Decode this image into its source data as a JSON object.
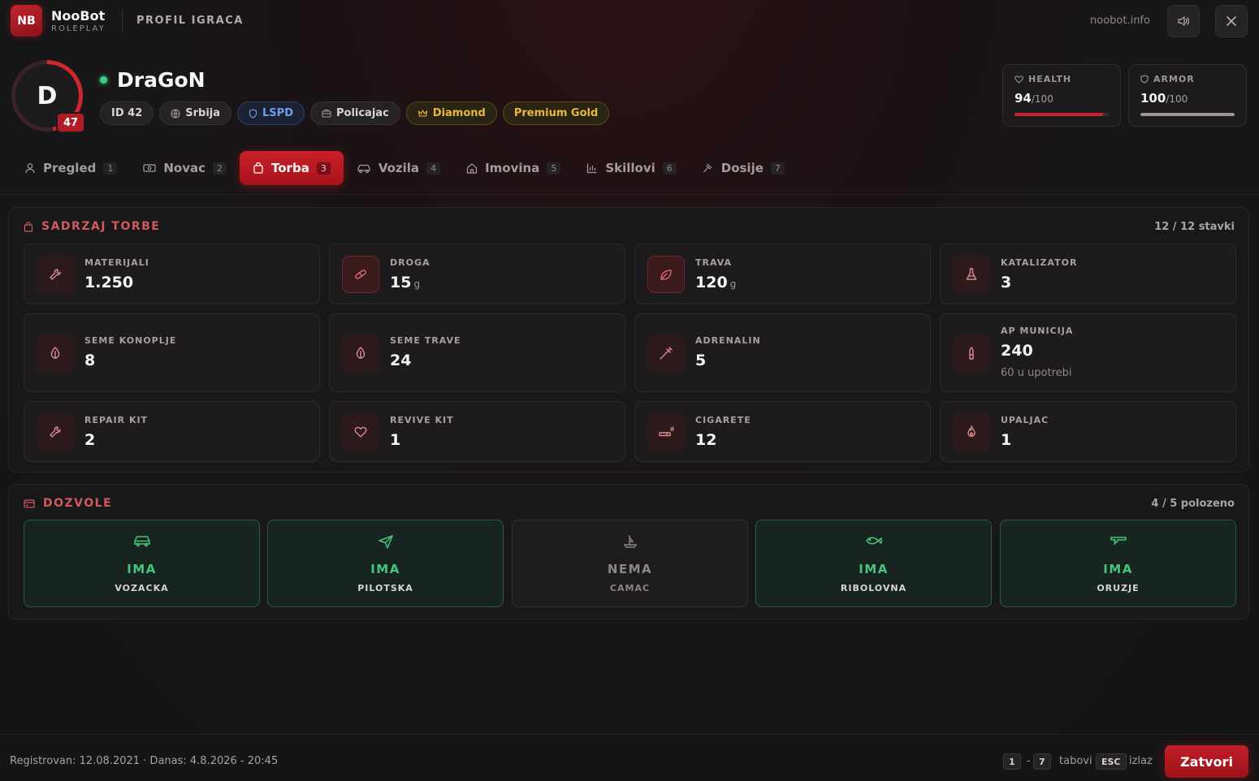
{
  "header": {
    "logo": "NB",
    "brand": "NooBot",
    "brand_sub": "ROLEPLAY",
    "page_title": "PROFIL IGRACA",
    "site": "noobot.info"
  },
  "profile": {
    "avatar_letter": "D",
    "level": "47",
    "name": "DraGoN",
    "status_color": "#3ecf7a",
    "chips": {
      "id": "ID 42",
      "country": "Srbija",
      "faction": "LSPD",
      "job": "Policajac",
      "rank": "Diamond",
      "premium": "Premium Gold"
    }
  },
  "stats": {
    "health": {
      "label": "HEALTH",
      "value": "94",
      "max": "/100",
      "fraction": 0.94,
      "color": "#c8232c"
    },
    "armor": {
      "label": "ARMOR",
      "value": "100",
      "max": "/100",
      "fraction": 1.0,
      "color": "#9a9596"
    }
  },
  "tabs": [
    {
      "label": "Pregled",
      "num": "1",
      "icon": "user-icon"
    },
    {
      "label": "Novac",
      "num": "2",
      "icon": "money-icon"
    },
    {
      "label": "Torba",
      "num": "3",
      "icon": "bag-icon",
      "active": true
    },
    {
      "label": "Vozila",
      "num": "4",
      "icon": "car-icon"
    },
    {
      "label": "Imovina",
      "num": "5",
      "icon": "house-icon"
    },
    {
      "label": "Skillovi",
      "num": "6",
      "icon": "chart-icon"
    },
    {
      "label": "Dosije",
      "num": "7",
      "icon": "gavel-icon"
    }
  ],
  "inventory": {
    "title": "SADRZAJ TORBE",
    "count": "12 / 12 stavki",
    "items": [
      {
        "label": "MATERIJALI",
        "value": "1.250",
        "unit": "",
        "icon": "wrench-icon"
      },
      {
        "label": "DROGA",
        "value": "15",
        "unit": "g",
        "icon": "pill-icon"
      },
      {
        "label": "TRAVA",
        "value": "120",
        "unit": "g",
        "icon": "leaf-icon"
      },
      {
        "label": "KATALIZATOR",
        "value": "3",
        "unit": "",
        "icon": "flask-icon"
      },
      {
        "label": "SEME KONOPLJE",
        "value": "8",
        "unit": "",
        "icon": "seed-icon"
      },
      {
        "label": "SEME TRAVE",
        "value": "24",
        "unit": "",
        "icon": "seed-icon"
      },
      {
        "label": "ADRENALIN",
        "value": "5",
        "unit": "",
        "icon": "syringe-icon"
      },
      {
        "label": "AP MUNICIJA",
        "value": "240",
        "unit": "",
        "sub": "60 u upotrebi",
        "icon": "bullet-icon"
      },
      {
        "label": "REPAIR KIT",
        "value": "2",
        "unit": "",
        "icon": "wrench-icon"
      },
      {
        "label": "REVIVE KIT",
        "value": "1",
        "unit": "",
        "icon": "heart-icon"
      },
      {
        "label": "CIGARETE",
        "value": "12",
        "unit": "",
        "icon": "cigarette-icon"
      },
      {
        "label": "UPALJAC",
        "value": "1",
        "unit": "",
        "icon": "flame-icon"
      }
    ]
  },
  "licenses": {
    "title": "DOZVOLE",
    "count": "4 / 5 polozeno",
    "items": [
      {
        "status": "IMA",
        "name": "VOZACKA",
        "icon": "car-icon",
        "has": true
      },
      {
        "status": "IMA",
        "name": "PILOTSKA",
        "icon": "plane-icon",
        "has": true
      },
      {
        "status": "NEMA",
        "name": "CAMAC",
        "icon": "boat-icon",
        "has": false
      },
      {
        "status": "IMA",
        "name": "RIBOLOVNA",
        "icon": "fish-icon",
        "has": true
      },
      {
        "status": "IMA",
        "name": "ORUZJE",
        "icon": "gun-icon",
        "has": true
      }
    ]
  },
  "footer": {
    "registered": "Registrovan: 12.08.2021 · Danas: 4.8.2026 - 20:45",
    "key_from": "1",
    "dash": "-",
    "key_to": "7",
    "tabs_label": "tabovi",
    "esc_key": "ESC",
    "exit_label": "izlaz",
    "close_button": "Zatvori"
  }
}
